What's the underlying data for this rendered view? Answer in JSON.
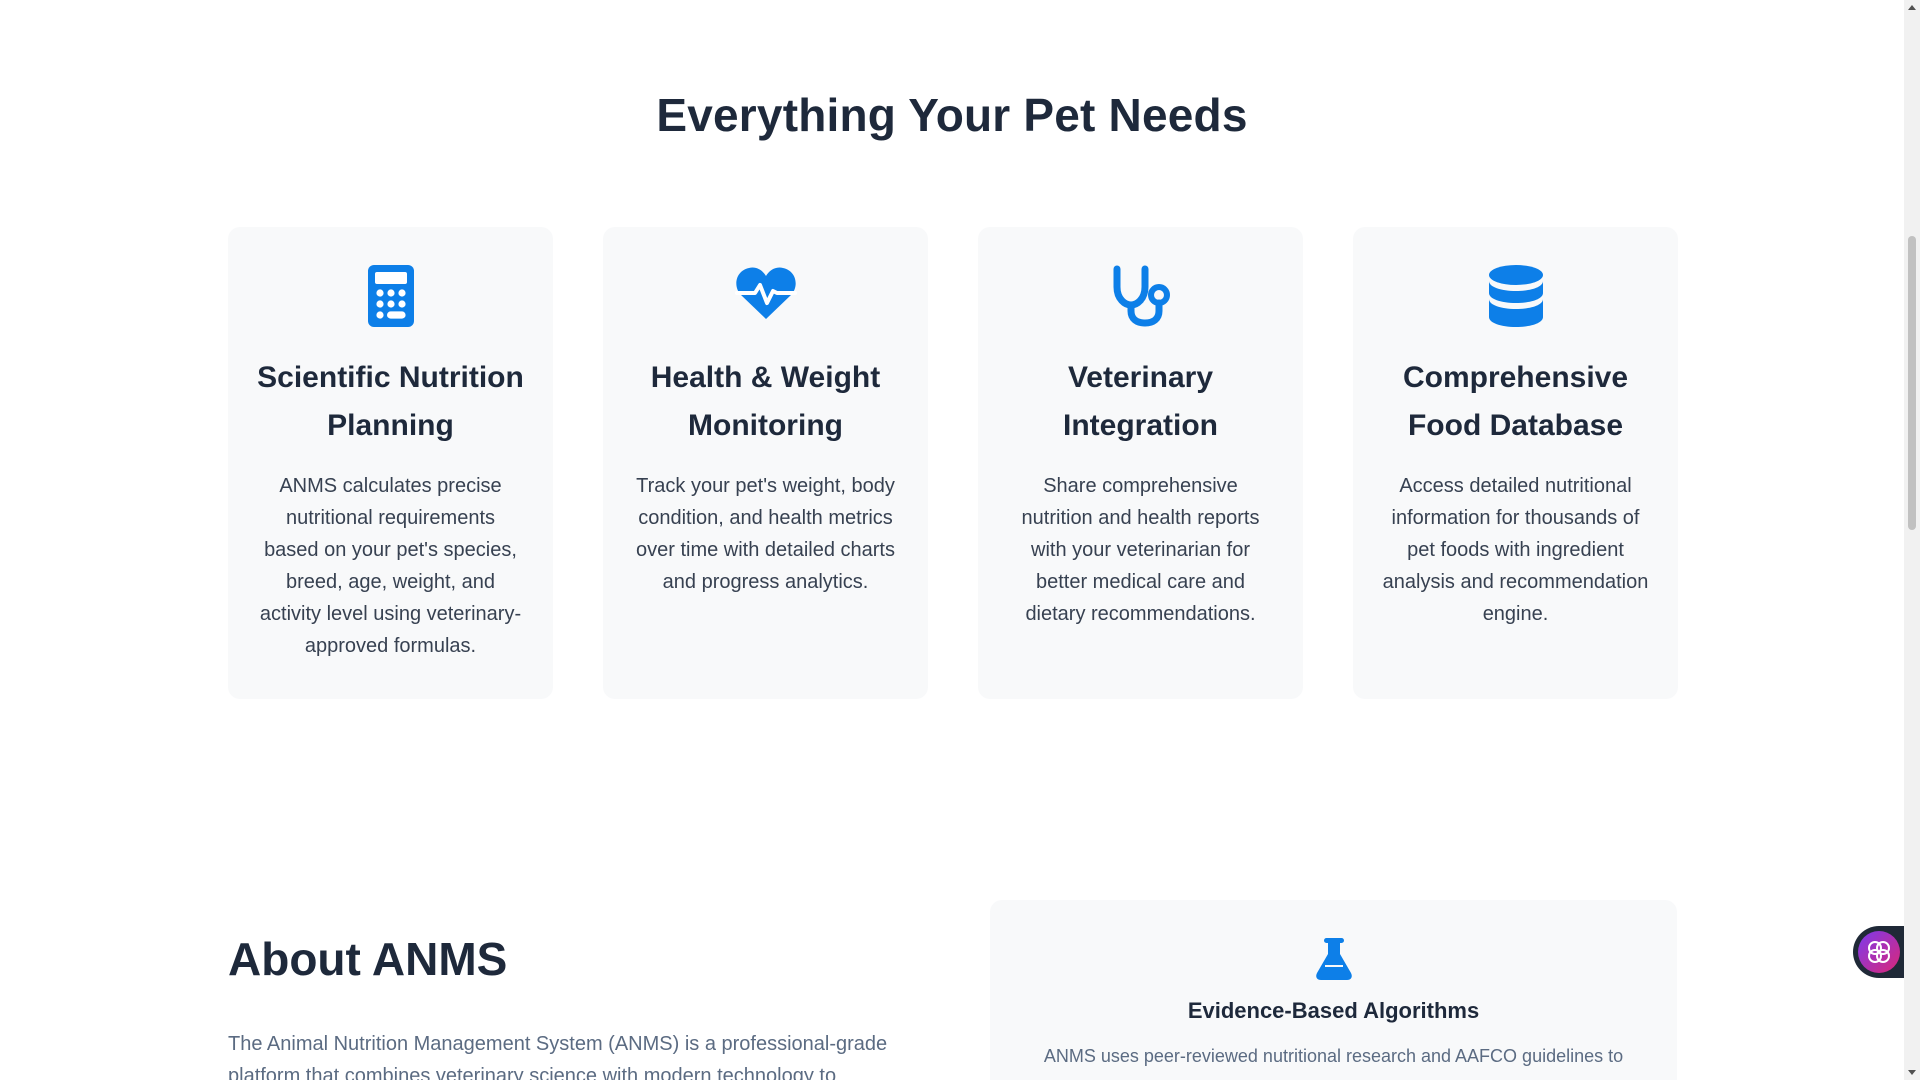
{
  "features": {
    "title": "Everything Your Pet Needs",
    "cards": [
      {
        "icon": "calculator-icon",
        "title": "Scientific Nutrition Planning",
        "description": "ANMS calculates precise nutritional requirements based on your pet's species, breed, age, weight, and activity level using veterinary-approved formulas."
      },
      {
        "icon": "heart-pulse-icon",
        "title": "Health & Weight Monitoring",
        "description": "Track your pet's weight, body condition, and health metrics over time with detailed charts and progress analytics."
      },
      {
        "icon": "stethoscope-icon",
        "title": "Veterinary Integration",
        "description": "Share comprehensive nutrition and health reports with your veterinarian for better medical care and dietary recommendations."
      },
      {
        "icon": "database-icon",
        "title": "Comprehensive Food Database",
        "description": "Access detailed nutritional information for thousands of pet foods with ingredient analysis and recommendation engine."
      }
    ]
  },
  "about": {
    "title": "About ANMS",
    "text": "The Animal Nutrition Management System (ANMS) is a professional-grade platform that combines veterinary science with modern technology to"
  },
  "algorithms": {
    "icon": "flask-icon",
    "title": "Evidence-Based Algorithms",
    "description": "ANMS uses peer-reviewed nutritional research and AAFCO guidelines to"
  },
  "assistant": {
    "icon": "brain-icon"
  },
  "colors": {
    "accent": "#0d7fe8",
    "heading": "#1e293b",
    "card_bg": "#f8f9fa"
  }
}
